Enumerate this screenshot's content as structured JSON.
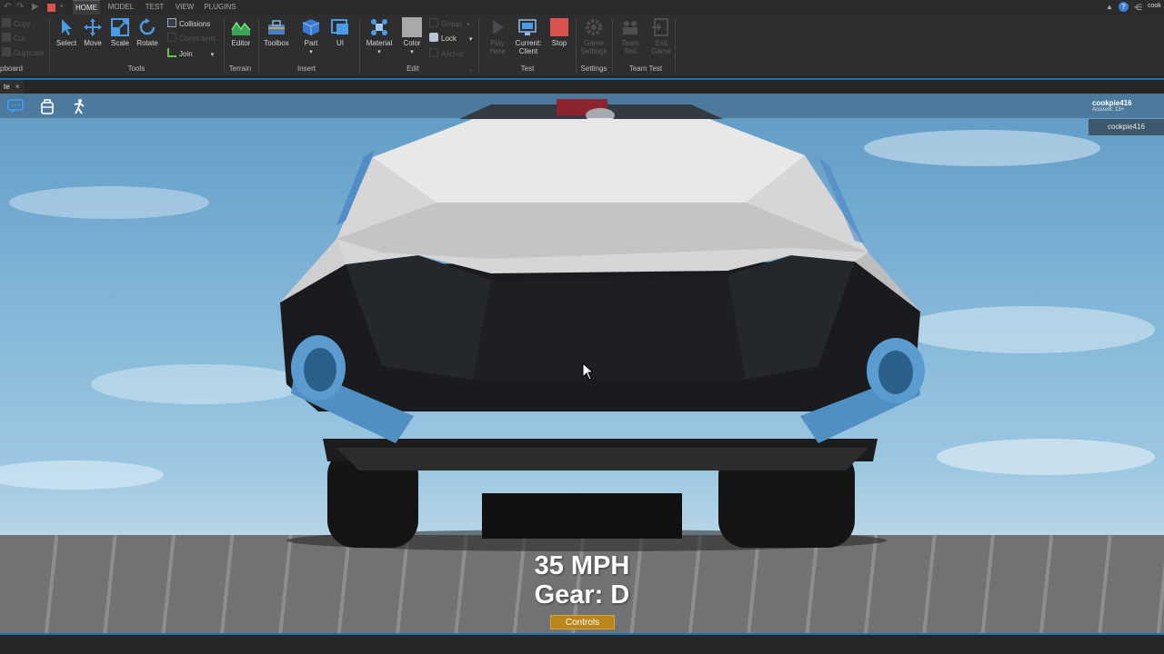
{
  "menu": {
    "tabs": [
      "HOME",
      "MODEL",
      "TEST",
      "VIEW",
      "PLUGINS"
    ],
    "active_tab": "HOME",
    "user_partial": "cook"
  },
  "ribbon": {
    "clipboard": {
      "copy": "Copy",
      "cut": "Cut",
      "duplicate": "Duplicate",
      "group_label": "pboard"
    },
    "tools": {
      "select": "Select",
      "move": "Move",
      "scale": "Scale",
      "rotate": "Rotate",
      "collisions": "Collisions",
      "constraints": "Constraints",
      "join": "Join",
      "group_label": "Tools"
    },
    "terrain": {
      "editor": "Editor",
      "group_label": "Terrain"
    },
    "insert": {
      "toolbox": "Toolbox",
      "part": "Part",
      "ui": "UI",
      "group_label": "Insert"
    },
    "edit": {
      "material": "Material",
      "color": "Color",
      "group": "Group",
      "lock": "Lock",
      "anchor": "Anchor",
      "group_label": "Edit"
    },
    "test": {
      "play_here_1": "Play",
      "play_here_2": "Here",
      "current_1": "Current:",
      "current_2": "Client",
      "stop": "Stop",
      "group_label": "Test"
    },
    "settings": {
      "game_1": "Game",
      "game_2": "Settings",
      "group_label": "Settings"
    },
    "team_test": {
      "team_1": "Team",
      "team_2": "Test",
      "exit_1": "Exit",
      "exit_2": "Game",
      "group_label": "Team Test"
    }
  },
  "doc_tab": {
    "label": "te",
    "close": "×"
  },
  "viewport": {
    "user": {
      "name": "cookpie416",
      "account": "Account: 13+"
    },
    "player_list": [
      "cookpie416"
    ],
    "speed_text": "35 MPH",
    "gear_text": "Gear: D",
    "controls_label": "Controls"
  },
  "colors": {
    "accent": "#1f6fbf",
    "controls_button": "#b8861b",
    "stop_red": "#d9534f",
    "select_blue": "#4a9be8"
  }
}
